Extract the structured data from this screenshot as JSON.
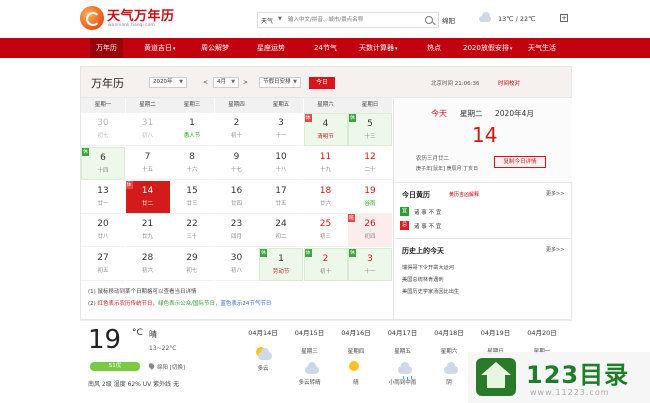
{
  "header": {
    "logo_title": "天气万年历",
    "logo_sub": "wannianli.tianqi.com",
    "search_type": "天气",
    "search_placeholder": "输入中文/拼音、城市/景点名称",
    "city": "绵阳",
    "temp": "13℃ / 22℃",
    "plus": "+"
  },
  "nav": [
    {
      "label": "万年历",
      "caret": ""
    },
    {
      "label": "黄道吉日",
      "caret": "▾"
    },
    {
      "label": "周公解梦",
      "caret": ""
    },
    {
      "label": "星座运势",
      "caret": ""
    },
    {
      "label": "24节气",
      "caret": ""
    },
    {
      "label": "天数计算器",
      "caret": "▾"
    },
    {
      "label": "热点",
      "caret": ""
    },
    {
      "label": "2020放假安排",
      "caret": "▾"
    },
    {
      "label": "天气生活",
      "caret": ""
    }
  ],
  "calendar": {
    "title": "万年历",
    "year_select": "2020年",
    "prev": "<",
    "month_select": "4月",
    "next": ">",
    "holiday_select": "节假日安排",
    "today_button": "今日",
    "beijing_time": "北京时间 21:06:36",
    "calibrate": "时间校对",
    "weekdays": [
      "星期一",
      "星期二",
      "星期三",
      "星期四",
      "星期五",
      "星期六",
      "星期日"
    ],
    "weeks": [
      [
        {
          "d": "30",
          "l": "初七",
          "style": "grey"
        },
        {
          "d": "31",
          "l": "初八",
          "style": "grey"
        },
        {
          "d": "1",
          "l": "愚人节",
          "style": "",
          "lstyle": "term"
        },
        {
          "d": "2",
          "l": "初十",
          "style": ""
        },
        {
          "d": "3",
          "l": "十一",
          "style": ""
        },
        {
          "d": "4",
          "l": "清明节",
          "style": "green",
          "lstyle": "fest",
          "tag": "休",
          "tagtype": "rest"
        },
        {
          "d": "5",
          "l": "十三",
          "style": "green",
          "tag": "休",
          "tagtype": "work"
        }
      ],
      [
        {
          "d": "6",
          "l": "十四",
          "style": "green",
          "tag": "休",
          "tagtype": "work"
        },
        {
          "d": "7",
          "l": "十五",
          "style": ""
        },
        {
          "d": "8",
          "l": "十六",
          "style": ""
        },
        {
          "d": "9",
          "l": "十七",
          "style": ""
        },
        {
          "d": "10",
          "l": "十八",
          "style": ""
        },
        {
          "d": "11",
          "l": "十九",
          "style": "wkend"
        },
        {
          "d": "12",
          "l": "二十",
          "style": "wkend"
        }
      ],
      [
        {
          "d": "13",
          "l": "廿一",
          "style": ""
        },
        {
          "d": "14",
          "l": "廿二",
          "style": "today",
          "tag": "休",
          "tagtype": "rest"
        },
        {
          "d": "15",
          "l": "廿三",
          "style": ""
        },
        {
          "d": "16",
          "l": "廿四",
          "style": ""
        },
        {
          "d": "17",
          "l": "廿五",
          "style": ""
        },
        {
          "d": "18",
          "l": "廿六",
          "style": "wkend"
        },
        {
          "d": "19",
          "l": "谷雨",
          "style": "wkend",
          "lstyle": "term"
        }
      ],
      [
        {
          "d": "20",
          "l": "廿八",
          "style": ""
        },
        {
          "d": "21",
          "l": "廿九",
          "style": ""
        },
        {
          "d": "22",
          "l": "三十",
          "style": ""
        },
        {
          "d": "23",
          "l": "四月",
          "style": ""
        },
        {
          "d": "24",
          "l": "初二",
          "style": ""
        },
        {
          "d": "25",
          "l": "初三",
          "style": "wkend"
        },
        {
          "d": "26",
          "l": "初四",
          "style": "wkend pink",
          "tag": "班",
          "tagtype": "rest"
        }
      ],
      [
        {
          "d": "27",
          "l": "初五",
          "style": ""
        },
        {
          "d": "28",
          "l": "初六",
          "style": ""
        },
        {
          "d": "29",
          "l": "初七",
          "style": ""
        },
        {
          "d": "30",
          "l": "初八",
          "style": ""
        },
        {
          "d": "1",
          "l": "劳动节",
          "style": "green",
          "lstyle": "fest",
          "tag": "休",
          "tagtype": "work"
        },
        {
          "d": "2",
          "l": "初十",
          "style": "green wkend",
          "tag": "休",
          "tagtype": "work"
        },
        {
          "d": "3",
          "l": "十一",
          "style": "green wkend",
          "tag": "休",
          "tagtype": "work"
        }
      ]
    ]
  },
  "today": {
    "label": "今天",
    "week": "星期二",
    "year_month": "2020年4月",
    "day": "14",
    "lunar": "农历三月廿二",
    "ganzhi": "庚子年[鼠年] 庚辰月 丁亥日",
    "copy_button": "复制今日详情"
  },
  "almanac": {
    "title": "今日黄历",
    "subtitle": "黄历吉凶解释",
    "more": "更多>>",
    "yi_badge": "宜",
    "yi_text": "诸 事 不 宜",
    "ji_badge": "忌",
    "ji_text": "诸 事 不 宜"
  },
  "history": {
    "title": "历史上的今天",
    "more": "更多>>",
    "items": [
      "瑞得哥下令开凿大运河",
      "美国总统林肯遇刺",
      "美国历史学家汤因比出生"
    ]
  },
  "notes": {
    "line1": "(1) 鼠标移动到某个日期格可以查看当日详情",
    "line2_prefix": "(2)",
    "line2_red": "红色表示农历传统节日，",
    "line2_green": "绿色表示公众/国际节日，",
    "line2_blue": "蓝色表示24节气节日"
  },
  "weather": {
    "temp": "19",
    "deg": "°C",
    "cond": "晴",
    "range": "13~22°C",
    "aqi": "51优",
    "city": "绵阳 [切换]",
    "detail": "南风 2级  湿度 62%  UV 紫外线 无",
    "forecast": [
      {
        "date": "04月14日",
        "week": "",
        "cond": "多云",
        "icon": "sun-cloud"
      },
      {
        "date": "04月15日",
        "week": "星期三",
        "cond": "多云转晴",
        "icon": "cloud"
      },
      {
        "date": "04月16日",
        "week": "星期四",
        "cond": "晴",
        "icon": "sun"
      },
      {
        "date": "04月17日",
        "week": "星期五",
        "cond": "小雨到中雨",
        "icon": "rain"
      },
      {
        "date": "04月18日",
        "week": "星期六",
        "cond": "阴",
        "icon": "cloud"
      },
      {
        "date": "04月19日",
        "week": "星期日",
        "cond": "",
        "icon": ""
      },
      {
        "date": "04月20日",
        "week": "星期一",
        "cond": "",
        "icon": ""
      }
    ]
  },
  "watermark": {
    "title": "123目录",
    "url": "www.11223.com"
  }
}
